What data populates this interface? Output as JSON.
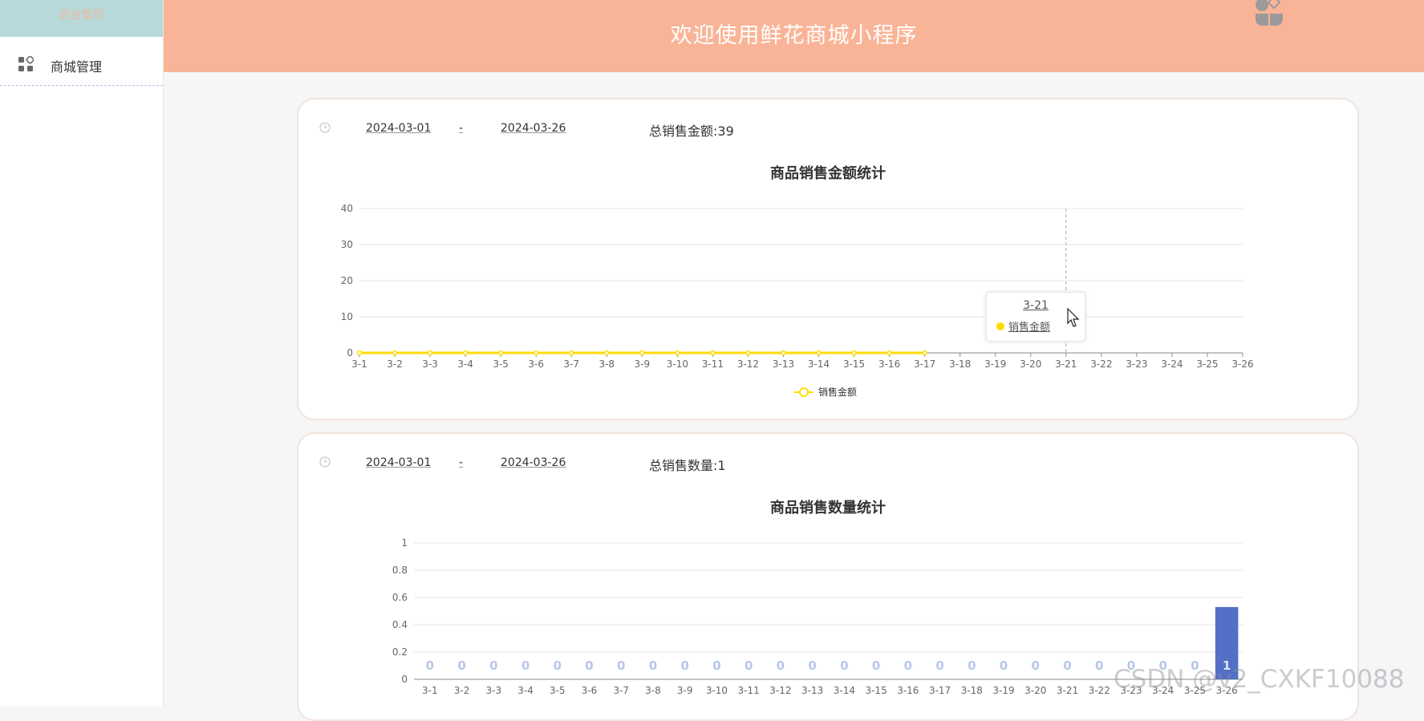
{
  "sidebar": {
    "home_label": "后台首页",
    "items": [
      {
        "label": "商城管理",
        "icon": "apps-icon"
      }
    ]
  },
  "header": {
    "title": "欢迎使用鲜花商城小程序",
    "avatar_icon": "avatar-icon"
  },
  "sales_amount_panel": {
    "start_date": "2024-03-01",
    "separator": "-",
    "end_date": "2024-03-26",
    "total_label": "总销售金额:",
    "total_value": "39",
    "tooltip": {
      "date": "3-21",
      "series": "销售金额",
      "dot_color": "#ffdc00"
    }
  },
  "sales_qty_panel": {
    "start_date": "2024-03-01",
    "separator": "-",
    "end_date": "2024-03-26",
    "total_label": "总销售数量:",
    "total_value": "1"
  },
  "chart_data": [
    {
      "type": "line",
      "title": "商品销售金额统计",
      "categories": [
        "3-1",
        "3-2",
        "3-3",
        "3-4",
        "3-5",
        "3-6",
        "3-7",
        "3-8",
        "3-9",
        "3-10",
        "3-11",
        "3-12",
        "3-13",
        "3-14",
        "3-15",
        "3-16",
        "3-17",
        "3-18",
        "3-19",
        "3-20",
        "3-21",
        "3-22",
        "3-23",
        "3-24",
        "3-25",
        "3-26"
      ],
      "series": [
        {
          "name": "销售金额",
          "color": "#ffdc00",
          "values": [
            0,
            0,
            0,
            0,
            0,
            0,
            0,
            0,
            0,
            0,
            0,
            0,
            0,
            0,
            0,
            0,
            0
          ]
        }
      ],
      "yticks": [
        0,
        10,
        20,
        30,
        40
      ],
      "ylim": [
        0,
        40
      ],
      "legend": "bottom-center",
      "grid": true
    },
    {
      "type": "bar",
      "title": "商品销售数量统计",
      "categories": [
        "3-1",
        "3-2",
        "3-3",
        "3-4",
        "3-5",
        "3-6",
        "3-7",
        "3-8",
        "3-9",
        "3-10",
        "3-11",
        "3-12",
        "3-13",
        "3-14",
        "3-15",
        "3-16",
        "3-17",
        "3-18",
        "3-19",
        "3-20",
        "3-21",
        "3-22",
        "3-23",
        "3-24",
        "3-25",
        "3-26"
      ],
      "series": [
        {
          "color": "#5470c6",
          "values": [
            0,
            0,
            0,
            0,
            0,
            0,
            0,
            0,
            0,
            0,
            0,
            0,
            0,
            0,
            0,
            0,
            0,
            0,
            0,
            0,
            0,
            0,
            0,
            0,
            0,
            0.53
          ],
          "labels": [
            "0",
            "0",
            "0",
            "0",
            "0",
            "0",
            "0",
            "0",
            "0",
            "0",
            "0",
            "0",
            "0",
            "0",
            "0",
            "0",
            "0",
            "0",
            "0",
            "0",
            "0",
            "0",
            "0",
            "0",
            "0",
            "1"
          ]
        }
      ],
      "yticks": [
        "0",
        "0.2",
        "0.4",
        "0.6",
        "0.8",
        "1"
      ],
      "ylim": [
        0,
        1
      ],
      "grid": true
    }
  ],
  "watermark": "CSDN @v2_CXKF10088"
}
